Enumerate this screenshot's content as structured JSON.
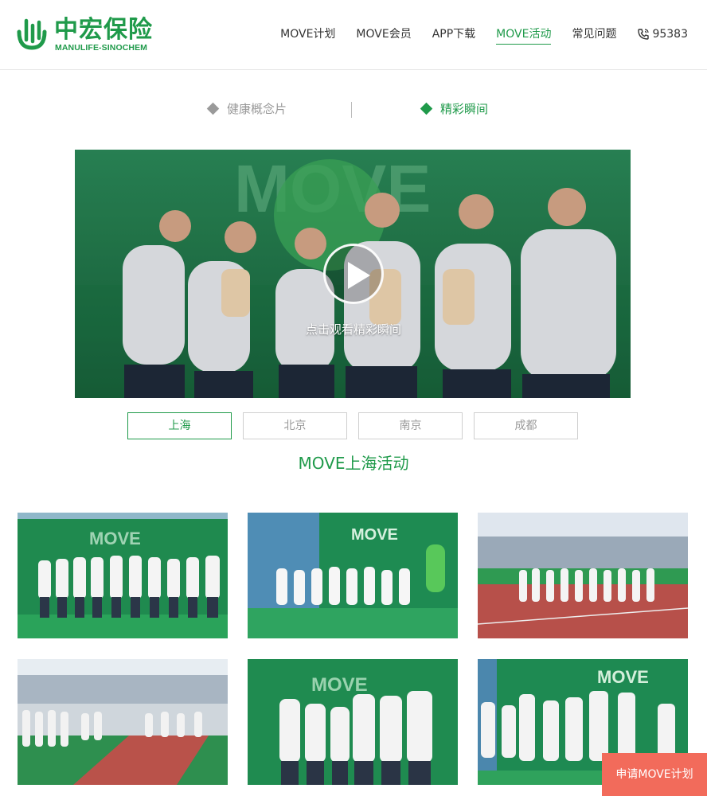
{
  "header": {
    "logo_cn": "中宏保险",
    "logo_en": "MANULIFE-SINOCHEM",
    "nav": [
      {
        "label": "MOVE计划",
        "active": false
      },
      {
        "label": "MOVE会员",
        "active": false
      },
      {
        "label": "APP下载",
        "active": false
      },
      {
        "label": "MOVE活动",
        "active": true
      },
      {
        "label": "常见问题",
        "active": false
      }
    ],
    "phone": "95383"
  },
  "subtabs": {
    "left": "健康概念片",
    "right": "精彩瞬间",
    "active": "right"
  },
  "video": {
    "caption": "点击观看精彩瞬间",
    "backdrop_text": "MOVE"
  },
  "city_tabs": [
    {
      "label": "上海",
      "active": true
    },
    {
      "label": "北京",
      "active": false
    },
    {
      "label": "南京",
      "active": false
    },
    {
      "label": "成都",
      "active": false
    }
  ],
  "section_title": "MOVE上海活动",
  "photos": [
    {
      "name": "photo-group-backdrop-1"
    },
    {
      "name": "photo-group-backdrop-2"
    },
    {
      "name": "photo-stadium-track-1"
    },
    {
      "name": "photo-stadium-crowd"
    },
    {
      "name": "photo-group-backdrop-3"
    },
    {
      "name": "photo-group-backdrop-4"
    }
  ],
  "apply_button": "申请MOVE计划",
  "colors": {
    "brand_green": "#1f9a4a",
    "apply_button": "#f26b5b"
  }
}
